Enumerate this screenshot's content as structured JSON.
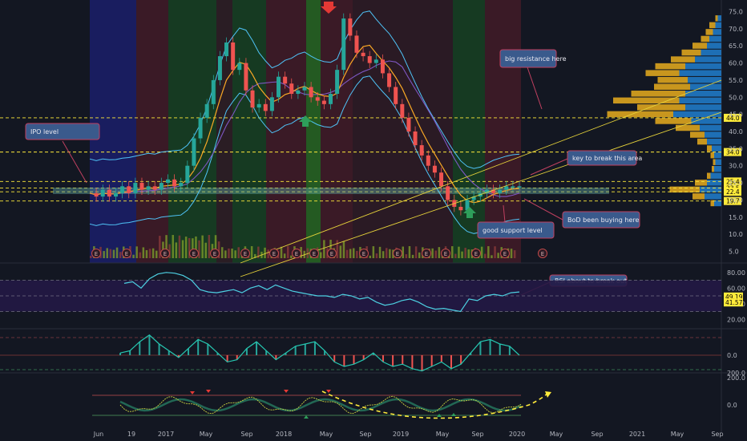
{
  "chart_data": {
    "type": "candlestick",
    "x_axis_labels": [
      "Jun",
      "19",
      "2017",
      "May",
      "Sep",
      "2018",
      "May",
      "Sep",
      "2019",
      "May",
      "Sep",
      "2020",
      "May",
      "Sep",
      "2021",
      "May",
      "Sep"
    ],
    "price_axis": {
      "ticks": [
        "5.0",
        "10.0",
        "15.0",
        "20.0",
        "25.0",
        "30.0",
        "35.0",
        "40.0",
        "45.0",
        "50.0",
        "55.0",
        "60.0",
        "65.0",
        "70.0",
        "75.0"
      ],
      "ylim": [
        3,
        77
      ]
    },
    "horizontal_levels": [
      {
        "value": "44.0"
      },
      {
        "value": "34.0"
      },
      {
        "value": "25.4"
      },
      {
        "value": "23.5"
      },
      {
        "value": "22.4"
      },
      {
        "value": "19.7"
      }
    ],
    "price_series": [
      22,
      21,
      23,
      21,
      22,
      24,
      22,
      25,
      23,
      24,
      23,
      25,
      26,
      24,
      25,
      30,
      38,
      44,
      48,
      55,
      62,
      66,
      58,
      60,
      52,
      47,
      48,
      46,
      50,
      56,
      54,
      51,
      52,
      53,
      50,
      49,
      48,
      51,
      58,
      73,
      68,
      63,
      62,
      60,
      61,
      57,
      53,
      48,
      44,
      40,
      36,
      33,
      30,
      28,
      24,
      20,
      18,
      17,
      20,
      21,
      22,
      23,
      22,
      23,
      24,
      24,
      24
    ],
    "rsi_axis": {
      "ticks": [
        "20.00",
        "40.00",
        "60.00",
        "80.00"
      ],
      "tags": [
        "49.19",
        "41.57"
      ]
    },
    "rsi_series": [
      66,
      68,
      60,
      72,
      78,
      80,
      79,
      76,
      70,
      58,
      55,
      54,
      56,
      58,
      54,
      60,
      63,
      58,
      64,
      60,
      56,
      54,
      52,
      50,
      50,
      48,
      52,
      50,
      46,
      48,
      42,
      38,
      40,
      44,
      46,
      42,
      36,
      33,
      34,
      32,
      30,
      46,
      44,
      50,
      52,
      50,
      54,
      55
    ],
    "osc_axis": {
      "ticks": [
        "0.0"
      ],
      "tag": "200.0"
    },
    "osc_series": [
      2,
      4,
      12,
      18,
      10,
      4,
      -2,
      6,
      14,
      10,
      2,
      -6,
      -4,
      6,
      12,
      4,
      -4,
      2,
      8,
      10,
      12,
      4,
      -6,
      -10,
      -8,
      -4,
      2,
      -6,
      -10,
      -8,
      -12,
      -14,
      -10,
      -6,
      -12,
      -8,
      2,
      12,
      14,
      10,
      8,
      0
    ],
    "wave_axis": {
      "ticks": [
        "200.0",
        "0.0"
      ]
    },
    "annotations": [
      {
        "text": "IPO level"
      },
      {
        "text": "big resistance here"
      },
      {
        "text": "key to break this area"
      },
      {
        "text": "BoD been buying here"
      },
      {
        "text": "good support level"
      },
      {
        "text": "RSI about to break out"
      }
    ],
    "earnings_marker": "E",
    "volume_profile": [
      {
        "price": 73,
        "buy": 0.02,
        "sell": 0.03
      },
      {
        "price": 71,
        "buy": 0.05,
        "sell": 0.05
      },
      {
        "price": 69,
        "buy": 0.06,
        "sell": 0.07
      },
      {
        "price": 67,
        "buy": 0.07,
        "sell": 0.1
      },
      {
        "price": 65,
        "buy": 0.12,
        "sell": 0.12
      },
      {
        "price": 63,
        "buy": 0.16,
        "sell": 0.17
      },
      {
        "price": 61,
        "buy": 0.2,
        "sell": 0.22
      },
      {
        "price": 59,
        "buy": 0.25,
        "sell": 0.3
      },
      {
        "price": 57,
        "buy": 0.28,
        "sell": 0.35
      },
      {
        "price": 55,
        "buy": 0.25,
        "sell": 0.28
      },
      {
        "price": 53,
        "buy": 0.3,
        "sell": 0.26
      },
      {
        "price": 51,
        "buy": 0.45,
        "sell": 0.3
      },
      {
        "price": 49,
        "buy": 0.55,
        "sell": 0.35
      },
      {
        "price": 47,
        "buy": 0.4,
        "sell": 0.3
      },
      {
        "price": 45,
        "buy": 0.55,
        "sell": 0.4
      },
      {
        "price": 43,
        "buy": 0.3,
        "sell": 0.25
      },
      {
        "price": 41,
        "buy": 0.2,
        "sell": 0.18
      },
      {
        "price": 39,
        "buy": 0.12,
        "sell": 0.14
      },
      {
        "price": 37,
        "buy": 0.08,
        "sell": 0.12
      },
      {
        "price": 35,
        "buy": 0.04,
        "sell": 0.08
      },
      {
        "price": 33,
        "buy": 0.03,
        "sell": 0.06
      },
      {
        "price": 31,
        "buy": 0.02,
        "sell": 0.05
      },
      {
        "price": 29,
        "buy": 0.02,
        "sell": 0.06
      },
      {
        "price": 27,
        "buy": 0.03,
        "sell": 0.09
      },
      {
        "price": 25,
        "buy": 0.1,
        "sell": 0.12
      },
      {
        "price": 23,
        "buy": 0.25,
        "sell": 0.18
      },
      {
        "price": 21,
        "buy": 0.1,
        "sell": 0.14
      },
      {
        "price": 19,
        "buy": 0.03,
        "sell": 0.06
      }
    ]
  },
  "colors": {
    "background": "#131722",
    "up": "#26a69a",
    "down": "#ef5350",
    "level": "#ffeb3b",
    "upper_band": "#4fc3f7",
    "ma_long": "#7e57c2",
    "ma_short": "#f9a825",
    "rsi": "#4dd0e1",
    "note_fill": "#3a5a8c",
    "note_border": "#c04060"
  }
}
